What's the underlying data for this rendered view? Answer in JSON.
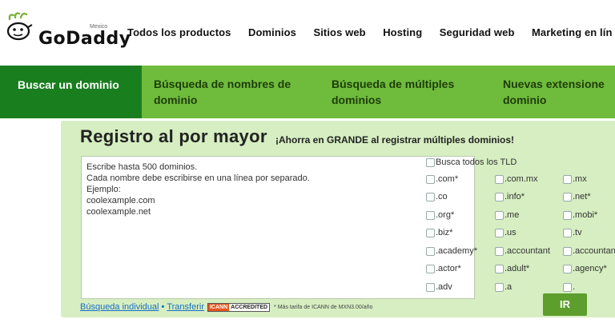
{
  "brand": {
    "name": "GoDaddy",
    "region": "Mexico",
    "accent": "#6fbb3c",
    "dark_green": "#197e1e"
  },
  "topnav": [
    "Todos los productos",
    "Dominios",
    "Sitios web",
    "Hosting",
    "Seguridad web",
    "Marketing en lín"
  ],
  "subnav": {
    "active": "Buscar un dominio",
    "tabs": [
      {
        "line1": "Búsqueda de nombres de",
        "line2": "dominio"
      },
      {
        "line1": "Búsqueda de múltiples",
        "line2": "dominios"
      },
      {
        "line1": "Nuevas extensione",
        "line2": "dominio"
      }
    ]
  },
  "panel": {
    "title": "Registro al por mayor",
    "subtitle": "¡Ahorra en GRANDE al registrar múltiples dominios!",
    "textarea_lines": [
      "Escribe hasta 500 dominios.",
      "Cada nombre debe escribirse en una línea por separado.",
      "Ejemplo:",
      "coolexample.com",
      "coolexample.net"
    ],
    "tld_all": "Busca todos los TLD",
    "tlds": [
      ".com*",
      ".com.mx",
      ".mx",
      ".co",
      ".info*",
      ".net*",
      ".org*",
      ".me",
      ".mobi*",
      ".biz*",
      ".us",
      ".tv",
      ".academy*",
      ".accountant",
      ".accountan",
      ".actor*",
      ".adult*",
      ".agency*",
      ".adv",
      ".a",
      "."
    ],
    "links": {
      "individual": "Búsqueda individual",
      "separator": "•",
      "transfer": "Transferir",
      "icann_left": "ICANN",
      "icann_right": "ACCREDITED",
      "fee_note": "* Más tarifa de ICANN de MXN3.00/año"
    },
    "go_button": "IR"
  }
}
